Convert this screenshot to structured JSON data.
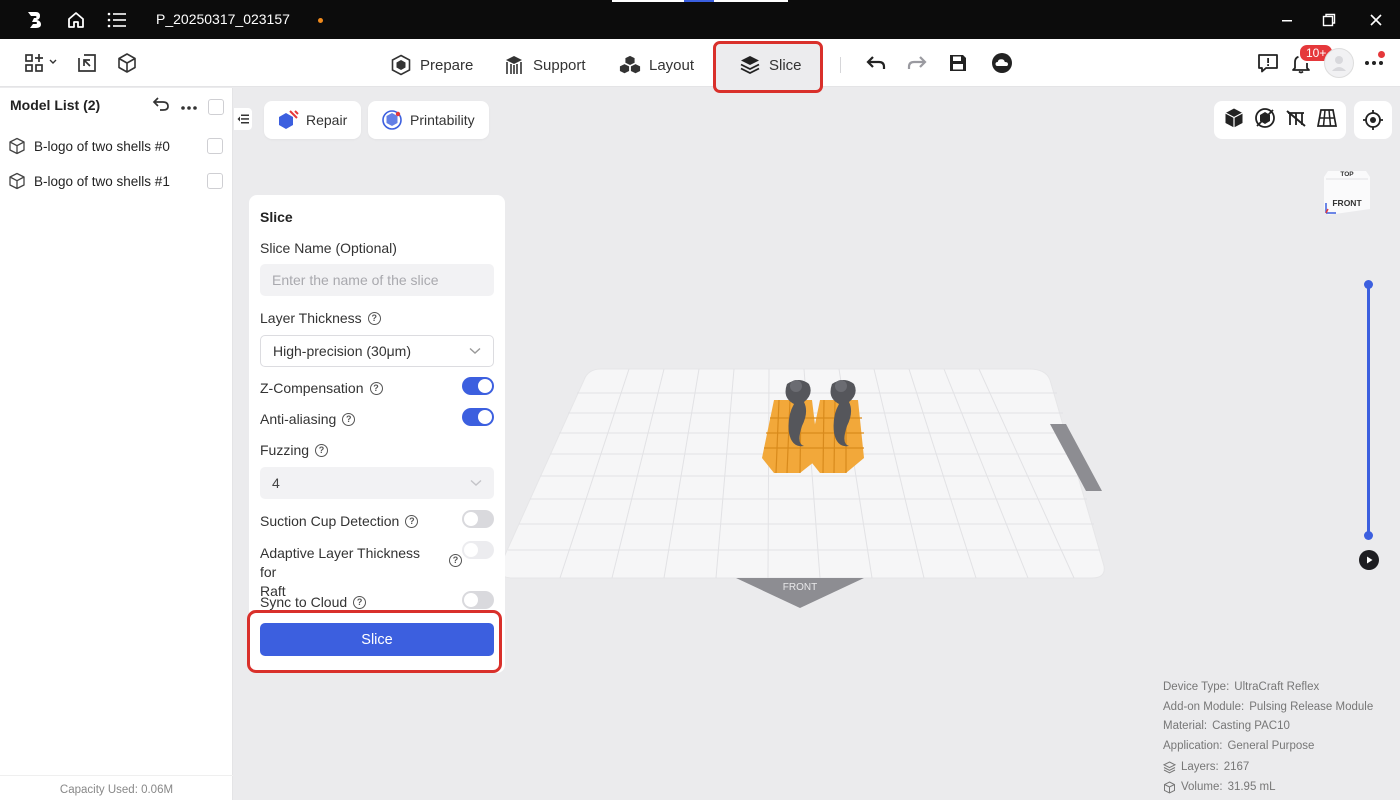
{
  "titlebar": {
    "project_name": "P_20250317_023157",
    "window_controls": [
      "minimize-icon",
      "restore-icon",
      "close-icon"
    ]
  },
  "toolbar": {
    "tabs": [
      {
        "label": "Prepare",
        "icon": "prepare-icon"
      },
      {
        "label": "Support",
        "icon": "support-icon"
      },
      {
        "label": "Layout",
        "icon": "layout-icon"
      },
      {
        "label": "Slice",
        "icon": "slice-icon",
        "active": true
      }
    ],
    "notification_badge": "10+"
  },
  "sidebar": {
    "header": "Model List (2)",
    "models": [
      {
        "name": "B-logo of two shells #0"
      },
      {
        "name": "B-logo of two shells #1"
      }
    ],
    "capacity": "Capacity Used: 0.06M"
  },
  "viewport": {
    "repair_label": "Repair",
    "printability_label": "Printability",
    "plate_front_label": "FRONT",
    "viewcube": {
      "top": "TOP",
      "front": "FRONT"
    }
  },
  "slice_panel": {
    "title": "Slice",
    "slice_name_label": "Slice Name (Optional)",
    "slice_name_placeholder": "Enter the name of the slice",
    "layer_thickness_label": "Layer Thickness",
    "layer_thickness_value": "High-precision (30μm)",
    "z_compensation_label": "Z-Compensation",
    "z_compensation_on": true,
    "anti_aliasing_label": "Anti-aliasing",
    "anti_aliasing_on": true,
    "fuzzing_label": "Fuzzing",
    "fuzzing_value": "4",
    "suction_cup_label": "Suction Cup Detection",
    "suction_cup_on": false,
    "adaptive_layer_label_1": "Adaptive Layer Thickness for",
    "adaptive_layer_label_2": "Raft",
    "adaptive_layer_on": false,
    "sync_cloud_label": "Sync to Cloud",
    "sync_cloud_on": false,
    "slice_button": "Slice"
  },
  "info": {
    "device_type_label": "Device Type:",
    "device_type": "UltraCraft Reflex",
    "addon_label": "Add-on Module:",
    "addon": "Pulsing Release Module",
    "material_label": "Material:",
    "material": "Casting PAC10",
    "application_label": "Application:",
    "application": "General Purpose",
    "layers_label": "Layers:",
    "layers": "2167",
    "volume_label": "Volume:",
    "volume": "31.95 mL"
  },
  "colors": {
    "accent": "#3c5fdf",
    "highlight": "#d9302b",
    "model": "#f2a83a"
  }
}
